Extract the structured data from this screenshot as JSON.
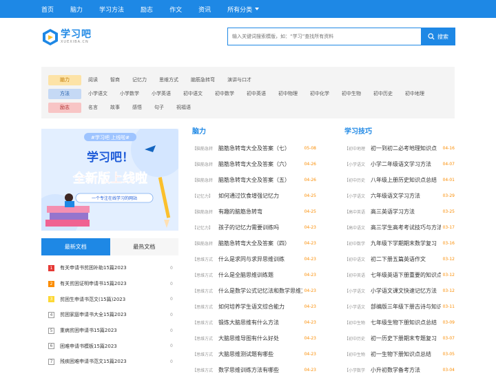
{
  "nav": {
    "items": [
      "首页",
      "脑力",
      "学习方法",
      "励志",
      "作文",
      "资讯",
      "所有分类"
    ]
  },
  "logo": {
    "title": "学习吧",
    "subtitle": "XUEXIBA.CN"
  },
  "search": {
    "placeholder": "输入关键词搜索模版，如：“学习”查找所有资料",
    "button": "搜索"
  },
  "categories": [
    {
      "tag": "脑力",
      "color": "#fde3a7",
      "items": [
        "阅读",
        "智商",
        "记忆力",
        "思维方式",
        "脑筋急转弯",
        "演讲与口才"
      ]
    },
    {
      "tag": "方法",
      "color": "#c5d9f5",
      "items": [
        "小学语文",
        "小学数学",
        "小学英语",
        "初中语文",
        "初中数学",
        "初中英语",
        "初中物理",
        "初中化学",
        "初中生物",
        "初中历史",
        "初中地理"
      ]
    },
    {
      "tag": "励志",
      "color": "#f8c5c5",
      "items": [
        "名言",
        "故事",
        "感悟",
        "句子",
        "祝福语"
      ]
    }
  ],
  "banner": {
    "tag": "#学习吧 上线啦#",
    "line1": "学习吧！",
    "line2": "全新版上线啦",
    "slogan": "一个专注在线学习的网站"
  },
  "tabs": {
    "newest": "最新文档",
    "hottest": "最热文档"
  },
  "left_list": [
    {
      "n": "1",
      "t": "有关申请书贫困补助15篇2023",
      "c": "0"
    },
    {
      "n": "2",
      "t": "有关贫困证明申请书15篇2023",
      "c": "0"
    },
    {
      "n": "3",
      "t": "贫困生申请书范文(15篇)2023",
      "c": "0"
    },
    {
      "n": "4",
      "t": "贫困家庭申请书大全15篇2023",
      "c": "0"
    },
    {
      "n": "5",
      "t": "重病贫困申请书15篇2023",
      "c": "0"
    },
    {
      "n": "6",
      "t": "困难申请书模板15篇2023",
      "c": "0"
    },
    {
      "n": "7",
      "t": "残疾困难申请书范文15篇2023",
      "c": "0"
    }
  ],
  "col_brain": {
    "title": "脑力",
    "rows": [
      {
        "tag": "【脑筋急转",
        "t": "脑筋急转弯大全及答案（七）",
        "d": "05-08"
      },
      {
        "tag": "【脑筋急转",
        "t": "脑筋急转弯大全及答案（六）",
        "d": "04-26"
      },
      {
        "tag": "【脑筋急转",
        "t": "脑筋急转弯大全及答案（五）",
        "d": "04-26"
      },
      {
        "tag": "【记忆力】",
        "t": "如何通过饮食增强记忆力",
        "d": "04-25"
      },
      {
        "tag": "【脑筋急转",
        "t": "有趣的脑筋急转弯",
        "d": "04-25"
      },
      {
        "tag": "【记忆力】",
        "t": "孩子的记忆力需要训练吗",
        "d": "04-23"
      },
      {
        "tag": "【脑筋急转",
        "t": "脑筋急转弯大全及答案（四）",
        "d": "04-23"
      },
      {
        "tag": "【思维方式",
        "t": "什么是求同与求异思维训练",
        "d": "04-23"
      },
      {
        "tag": "【思维方式",
        "t": "什么是全脑思维训练题",
        "d": "04-23"
      },
      {
        "tag": "【思维方式",
        "t": "什么是数学公式记忆法和数学思维方式",
        "d": "04-23"
      },
      {
        "tag": "【思维方式",
        "t": "如何培养学生语文综合能力",
        "d": "04-23"
      },
      {
        "tag": "【思维方式",
        "t": "锻炼大脑思维有什么方法",
        "d": "04-23"
      },
      {
        "tag": "【思维方式",
        "t": "大脑思维导图有什么好处",
        "d": "04-23"
      },
      {
        "tag": "【思维方式",
        "t": "大脑思维测试题有哪些",
        "d": "04-23"
      },
      {
        "tag": "【思维方式",
        "t": "数学思维训练方法有哪些",
        "d": "04-23"
      }
    ]
  },
  "col_skill": {
    "title": "学习技巧",
    "rows": [
      {
        "tag": "【初中地理",
        "t": "初一到初二必考地理知识点",
        "d": "04-16"
      },
      {
        "tag": "【小学语文",
        "t": "小学二年级语文学习方法",
        "d": "04-07"
      },
      {
        "tag": "【初中历史",
        "t": "八年级上册历史知识点总结",
        "d": "04-01"
      },
      {
        "tag": "【小学语文",
        "t": "六年级语文学习方法",
        "d": "03-29"
      },
      {
        "tag": "【高中英语",
        "t": "高三英语学习方法",
        "d": "03-25"
      },
      {
        "tag": "【高中语文",
        "t": "高三学生高考考试技巧与方法",
        "d": "03-17"
      },
      {
        "tag": "【初中数学",
        "t": "九年级下学期期末数学复习",
        "d": "03-16"
      },
      {
        "tag": "【初中语文",
        "t": "初二下册五篇英语作文",
        "d": "03-12"
      },
      {
        "tag": "【初中英语",
        "t": "七年级英语下册重要的知识点",
        "d": "03-12"
      },
      {
        "tag": "【小学语文",
        "t": "小学语文课文快速记忆方法",
        "d": "03-12"
      },
      {
        "tag": "【小学语文",
        "t": "部编版三年级下册古诗与知识",
        "d": "03-11"
      },
      {
        "tag": "【初中生物",
        "t": "七年级生物下册知识点总结",
        "d": "03-09"
      },
      {
        "tag": "【初中历史",
        "t": "初一历史下册期末专题复习",
        "d": "03-07"
      },
      {
        "tag": "【初中生物",
        "t": "初一生物下册知识点总结",
        "d": "03-05"
      },
      {
        "tag": "【小学数学",
        "t": "小升初数学备考方法",
        "d": "03-04"
      }
    ]
  },
  "colors": {
    "primary": "#1e88e5",
    "date": "#fb8c00"
  }
}
